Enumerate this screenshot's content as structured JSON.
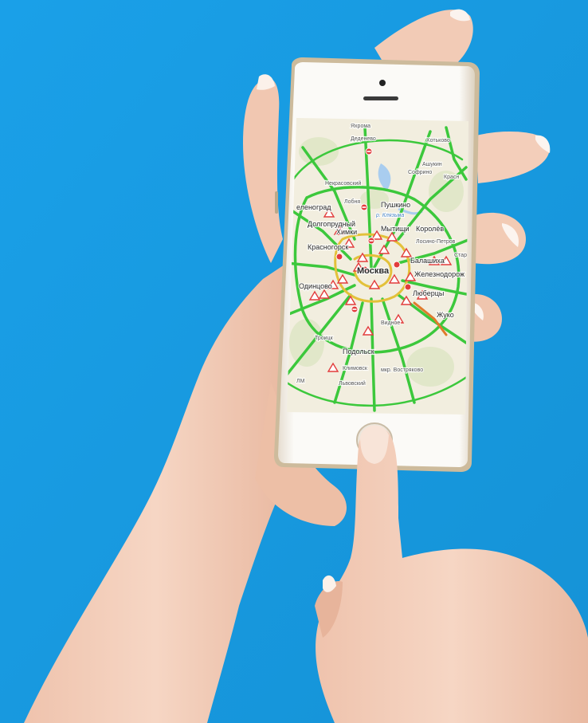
{
  "colors": {
    "background": "#1b9fe6",
    "skin": "#f3cdb8",
    "phone_body": "#f4f2ee",
    "phone_trim": "#d9c6a7",
    "map_land": "#f2eedf",
    "road_free": "#3cc83c",
    "road_slow": "#e8c63a",
    "incident": "#e23c3c"
  },
  "map": {
    "labels": {
      "yakhroma": "Яхрома",
      "dedenevo": "Деденево",
      "khotkovo": "Хотьково",
      "ashukino": "Ашукин",
      "sofrino": "Софрино",
      "krasnoarmeysk": "Красн",
      "nekrasovsky": "Некрасовский",
      "lobnya": "Лобня",
      "pushkino": "Пушкино",
      "zelenograd": "еленоград",
      "reservoir": "р. Клязьма",
      "dolgoprudny": "Долгопрудный",
      "khimki": "Химки",
      "mytishchi": "Мытищи",
      "korolev": "Королёв",
      "krasnogorsk": "Красногорск",
      "losino_petrovsky": "Лосино-Петров",
      "stars": "Стар",
      "moscow": "Москва",
      "balashikha": "Балашиха",
      "zheleznodorozhny": "Железнодорож",
      "odintsovo": "Одинцово",
      "lyubertsy": "Люберцы",
      "zhukovsky": "Жуко",
      "vidnoye": "Видное",
      "troitsk": "Троицк",
      "podolsk": "Подольск",
      "klimovsk": "Климовск",
      "bityagovo": "мкр. Востряково",
      "lvovsky": "Львовский",
      "ln": "ЛМ"
    }
  }
}
